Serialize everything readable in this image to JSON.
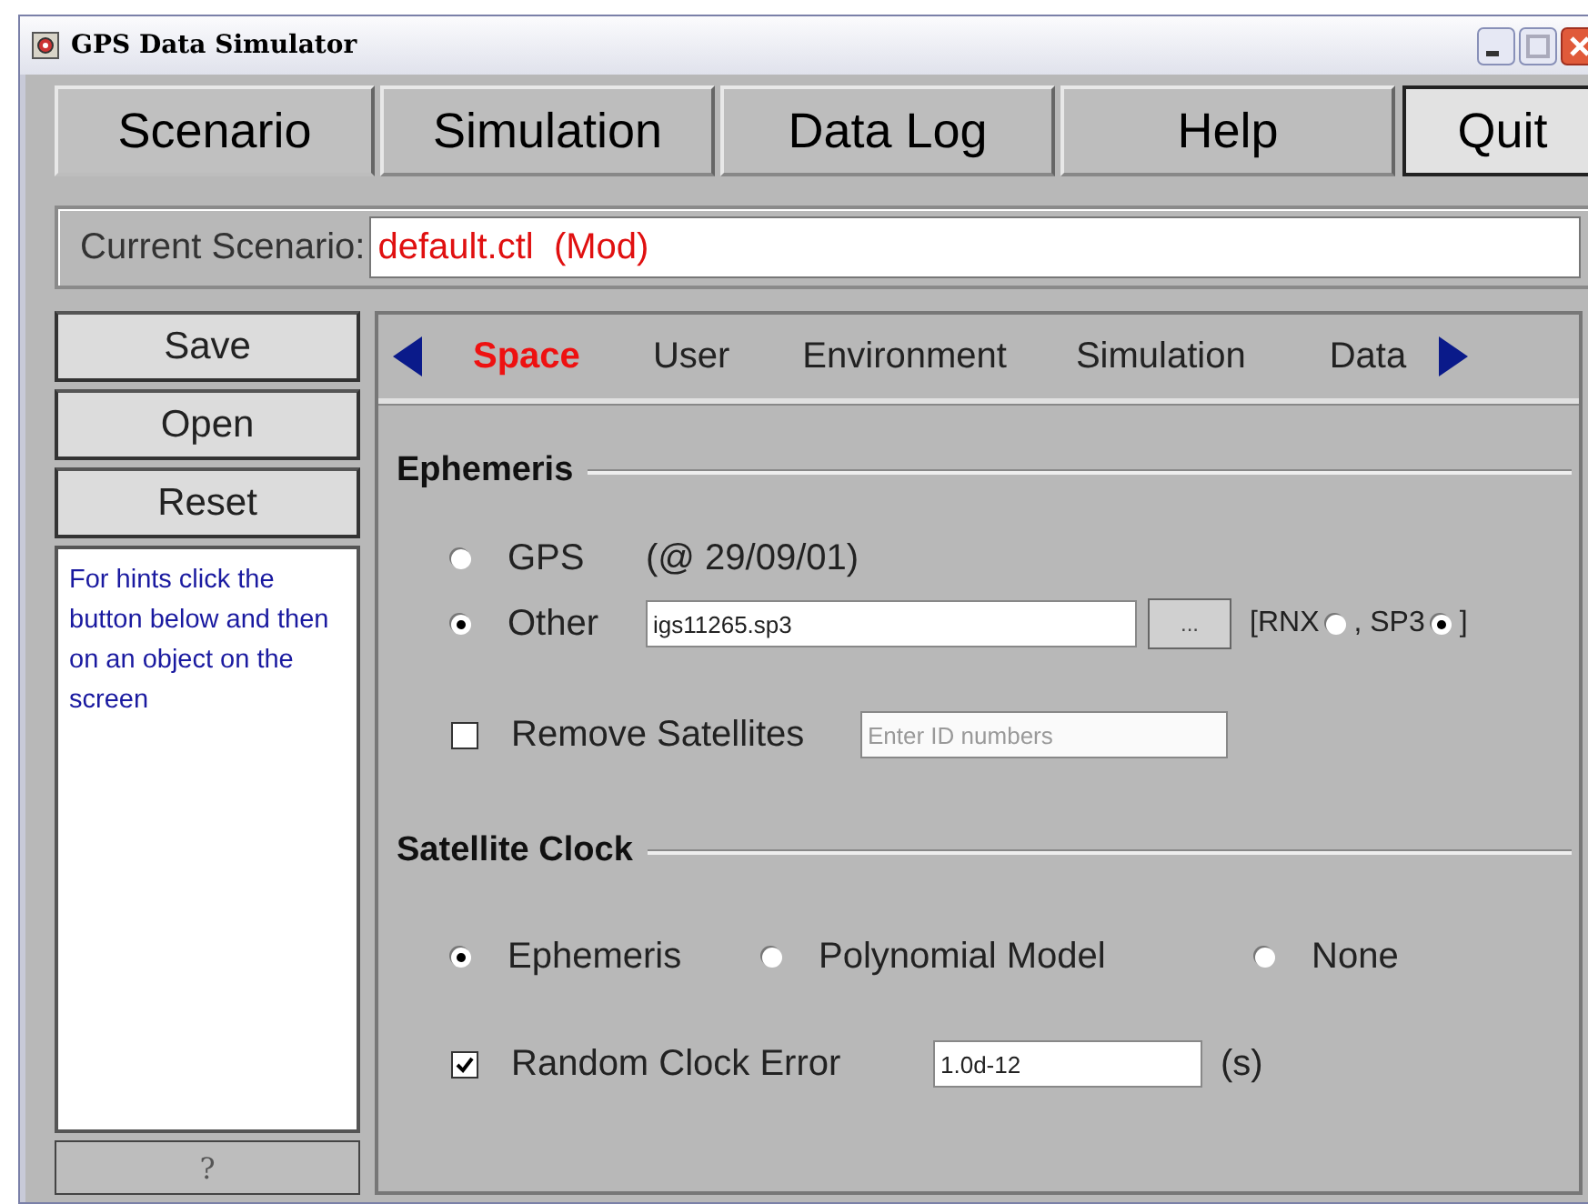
{
  "window": {
    "title": "GPS Data Simulator"
  },
  "menu_tabs": [
    {
      "label": "Scenario",
      "selected": true
    },
    {
      "label": "Simulation",
      "selected": false
    },
    {
      "label": "Data Log",
      "selected": false
    },
    {
      "label": "Help",
      "selected": false
    }
  ],
  "quit_button": "Quit",
  "current_scenario": {
    "label": "Current Scenario:",
    "value": "default.ctl  (Mod)"
  },
  "side_buttons": [
    "Save",
    "Open",
    "Reset"
  ],
  "hint_text": "For hints click the button below and then on an object on the screen",
  "hint_button": "?",
  "sub_tabs": [
    {
      "label": "Space",
      "selected": true
    },
    {
      "label": "User",
      "selected": false
    },
    {
      "label": "Environment",
      "selected": false
    },
    {
      "label": "Simulation",
      "selected": false
    },
    {
      "label": "Data",
      "selected": false
    }
  ],
  "ephemeris": {
    "heading": "Ephemeris",
    "gps": {
      "label": "GPS",
      "selected": false,
      "note": "(@ 29/09/01)"
    },
    "other": {
      "label": "Other",
      "selected": true,
      "value": "igs11265.sp3",
      "browse": "...",
      "format_open": "[",
      "formats": [
        {
          "label": "RNX",
          "selected": false
        },
        {
          "label": ", SP3",
          "selected": true
        }
      ],
      "format_close": "]"
    },
    "remove_satellites": {
      "label": "Remove Satellites",
      "checked": false,
      "placeholder": "Enter ID numbers"
    }
  },
  "satellite_clock": {
    "heading": "Satellite Clock",
    "models": [
      {
        "label": "Ephemeris",
        "selected": true
      },
      {
        "label": "Polynomial Model",
        "selected": false
      },
      {
        "label": "None",
        "selected": false
      }
    ],
    "random_error": {
      "label": "Random Clock Error",
      "checked": true,
      "value": "1.0d-12",
      "unit": "(s)"
    }
  }
}
